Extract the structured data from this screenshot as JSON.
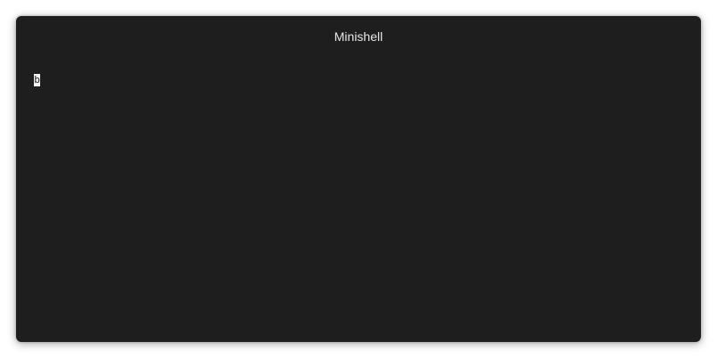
{
  "window": {
    "title": "Minishell"
  },
  "terminal": {
    "cursor_char": "b"
  },
  "colors": {
    "window_bg": "#1e1e1e",
    "title_text": "#e6e6e6",
    "cursor_bg": "#f2f2f2"
  }
}
